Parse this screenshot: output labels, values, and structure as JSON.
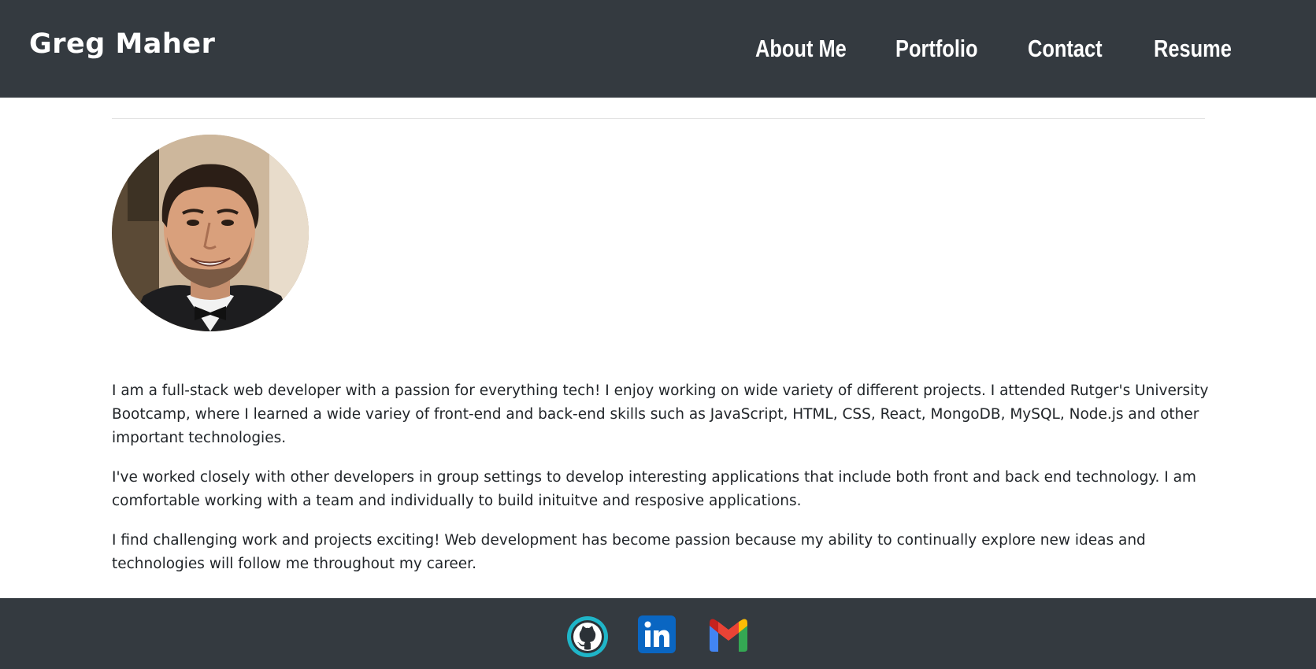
{
  "header": {
    "brand": "Greg Maher",
    "nav": {
      "about": "About Me",
      "portfolio": "Portfolio",
      "contact": "Contact",
      "resume": "Resume"
    }
  },
  "main": {
    "profile_photo": "profile-photo",
    "bio": [
      "I am a full-stack web developer with a passion for everything tech! I enjoy working on wide variety of different projects. I attended Rutger's University Bootcamp, where I learned a wide variey of front-end and back-end skills such as JavaScript, HTML, CSS, React, MongoDB, MySQL, Node.js and other important technologies.",
      "I've worked closely with other developers in group settings to develop interesting applications that include both front and back end technology. I am comfortable working with a team and individually to build inituitve and resposive applications.",
      "I find challenging work and projects exciting! Web development has become passion because my ability to continually explore new ideas and technologies will follow me throughout my career."
    ]
  },
  "footer": {
    "icons": [
      "github-icon",
      "linkedin-icon",
      "gmail-icon"
    ]
  },
  "colors": {
    "nav_background": "#343a40",
    "text": "#212529",
    "github_ring": "#1fb5c8",
    "linkedin_blue": "#0a66c2"
  }
}
